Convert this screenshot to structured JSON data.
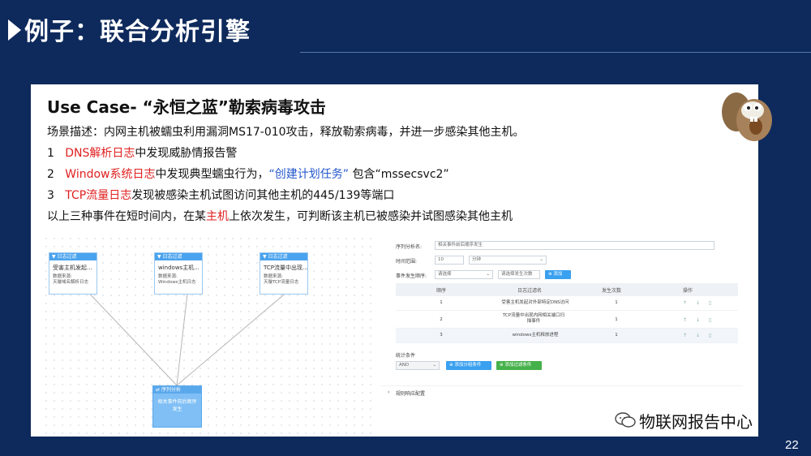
{
  "header": {
    "title": "例子：联合分析引擎"
  },
  "case": {
    "title": "Use Case- “永恒之蓝”勒索病毒攻击",
    "scenario": "场景描述：内网主机被蠕虫利用漏洞MS17-010攻击，释放勒索病毒，并进一步感染其他主机。",
    "step1_num": "1",
    "step1_red": "DNS解析日志",
    "step1_rest": "中发现威胁情报告警",
    "step2_num": "2",
    "step2_red": "Window系统日志",
    "step2_mid": "中发现典型蠕虫行为，",
    "step2_blue": "“创建计划任务”",
    "step2_rest": " 包含“mssecsvc2”",
    "step3_num": "3",
    "step3_red": "TCP流量日志",
    "step3_rest": "发现被感染主机试图访问其他主机的445/139等端口",
    "conclusion_a": "以上三种事件在短时间内，在某",
    "conclusion_red": "主机",
    "conclusion_b": "上依次发生，可判断该主机已被感染并试图感染其他主机"
  },
  "canvas": {
    "nodes": [
      {
        "head": "日志过滤",
        "name": "受害主机发起...",
        "src1": "数据来源:",
        "src2": "天璇域名解析日志"
      },
      {
        "head": "日志过滤",
        "name": "windows主机...",
        "src1": "数据来源:",
        "src2": "Windows主机日志"
      },
      {
        "head": "日志过滤",
        "name": "TCP流量中出现...",
        "src1": "数据来源:",
        "src2": "天璇TCP流量日志"
      }
    ],
    "seq_node": {
      "head": "序列分析",
      "body": "相关事件前后顺序发生"
    }
  },
  "panel": {
    "name_label": "序列分析名:",
    "name_value": "相关事件前后顺序发生",
    "time_label": "时间范围:",
    "time_value": "10",
    "time_unit": "分钟",
    "order_label": "事件发生顺序:",
    "order_placeholder": "请选择",
    "order_placeholder2": "请选择发生次数",
    "add_label": "添加",
    "columns": [
      "顺序",
      "日志过滤名",
      "发生次数",
      "操作"
    ],
    "rows": [
      {
        "order": "1",
        "name": "受害主机发起对外部特定DNS访问",
        "count": "1"
      },
      {
        "order": "2",
        "name": "TCP流量中出现内网相关端口扫描事件",
        "count": "1"
      },
      {
        "order": "3",
        "name": "windows主机释放进程",
        "count": "1"
      }
    ],
    "stat_label": "统计条件",
    "stat_select": "AND",
    "add_group": "添加分组条件",
    "add_filter": "添加过滤条件",
    "rule_label": "规则响应配置"
  },
  "footer": {
    "brand": "物联网报告中心",
    "page": "22"
  },
  "colors": {
    "background": "#0e2a5c",
    "red": "#e02020",
    "blue": "#2255cc",
    "node_blue": "#4aa3ee"
  }
}
